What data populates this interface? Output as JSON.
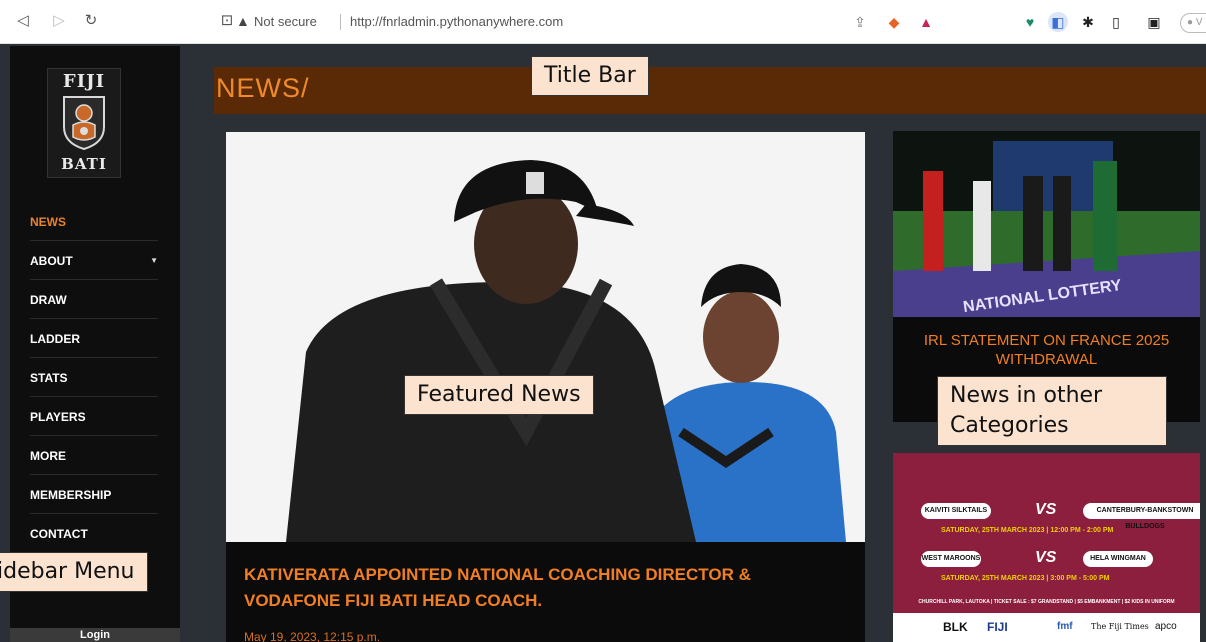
{
  "browser": {
    "back_icon": "back-arrow-icon",
    "forward_icon": "forward-arrow-icon",
    "reload_icon": "reload-icon",
    "security_label": "Not secure",
    "url": "http://fnrladmin.pythonanywhere.com",
    "pill_text": "● V"
  },
  "sidebar": {
    "logo_top": "FIJI",
    "logo_bottom": "BATI",
    "items": [
      {
        "label": "NEWS",
        "active": true
      },
      {
        "label": "ABOUT",
        "has_dropdown": true
      },
      {
        "label": "DRAW"
      },
      {
        "label": "LADDER"
      },
      {
        "label": "STATS"
      },
      {
        "label": "PLAYERS"
      },
      {
        "label": "MORE"
      },
      {
        "label": "MEMBERSHIP"
      },
      {
        "label": "CONTACT"
      }
    ],
    "login_label": "Login"
  },
  "main": {
    "title": "NEWS/",
    "featured": {
      "headline": "KATIVERATA APPOINTED NATIONAL COACHING DIRECTOR & VODAFONE FIJI BATI HEAD COACH.",
      "date": "May 19, 2023, 12:15 p.m."
    },
    "side_cards": [
      {
        "title": "IRL STATEMENT ON FRANCE 2025 WITHDRAWAL",
        "sign_text": "NATIONAL LOTTERY"
      },
      {
        "poster": {
          "match1_home": "KAIVITI SILKTAILS",
          "match1_away": "CANTERBURY-BANKSTOWN BULLDOGS",
          "match1_date": "SATURDAY, 25TH MARCH 2023 | 12:00 PM - 2:00 PM",
          "match2_home": "WEST MAROONS",
          "match2_away": "HELA WINGMAN",
          "match2_date": "SATURDAY, 25TH MARCH 2023 | 3:00 PM - 5:00 PM",
          "vs": "VS",
          "venue": "CHURCHILL PARK, LAUTOKA | TICKET SALE : $7 GRANDSTAND | $5 EMBANKMENT | $2 KIDS IN UNIFORM",
          "sponsors": [
            "BLK",
            "FIJI",
            "fmf",
            "The Fiji Times",
            "apco"
          ]
        }
      }
    ]
  },
  "annotations": {
    "title_bar": "Title Bar",
    "featured_news": "Featured News",
    "other_categories_1": "News in other",
    "other_categories_2": "Categories",
    "sidebar_menu": "idebar Menu"
  },
  "colors": {
    "accent_orange": "#f07f24",
    "title_bar_bg": "#5a2a07",
    "page_bg": "#2b2f36",
    "sidebar_bg": "#0e0e0e"
  }
}
